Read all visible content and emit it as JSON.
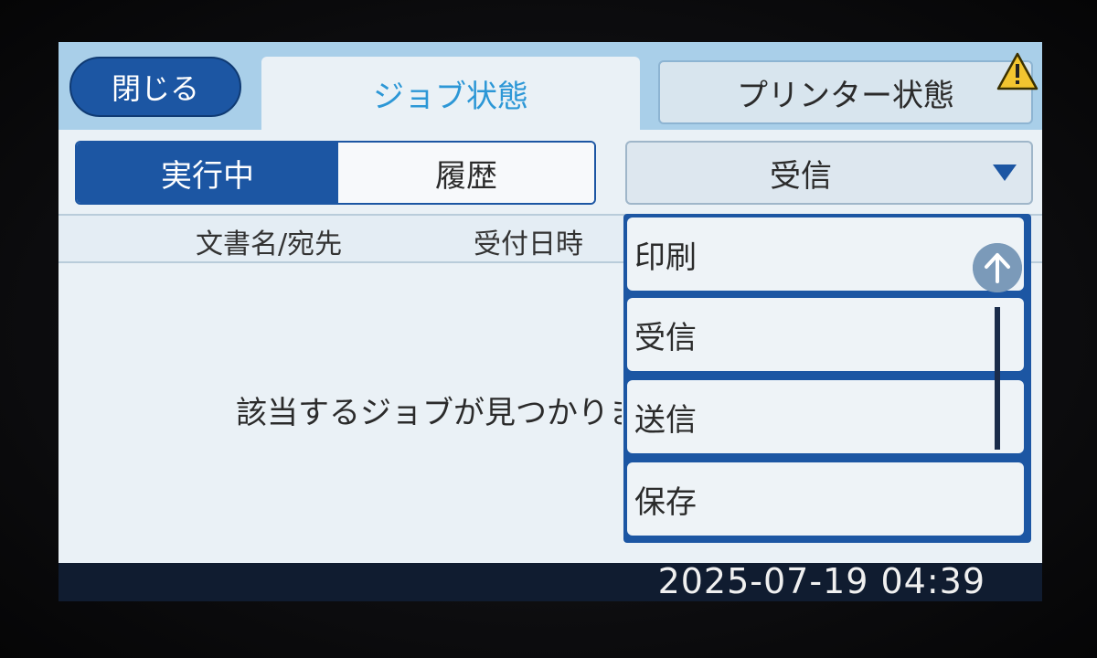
{
  "header": {
    "close_label": "閉じる",
    "tabs": [
      {
        "label": "ジョブ状態",
        "active": true
      },
      {
        "label": "プリンター状態",
        "active": false
      }
    ]
  },
  "segment": {
    "options": [
      "実行中",
      "履歴"
    ],
    "selected": "実行中"
  },
  "filter": {
    "selected": "受信",
    "options": [
      "印刷",
      "受信",
      "送信",
      "保存"
    ]
  },
  "table": {
    "columns": [
      "文書名/宛先",
      "受付日時"
    ],
    "empty_message": "該当するジョブが見つかりません。"
  },
  "status": {
    "datetime": "2025-07-19 04:39"
  },
  "colors": {
    "accent": "#1c56a3",
    "tab_active_text": "#2c97d6",
    "warning": "#f2c530"
  },
  "icons": {
    "warning": "warning-triangle-icon",
    "scroll_up": "arrow-up-icon",
    "dropdown": "triangle-down-icon"
  }
}
